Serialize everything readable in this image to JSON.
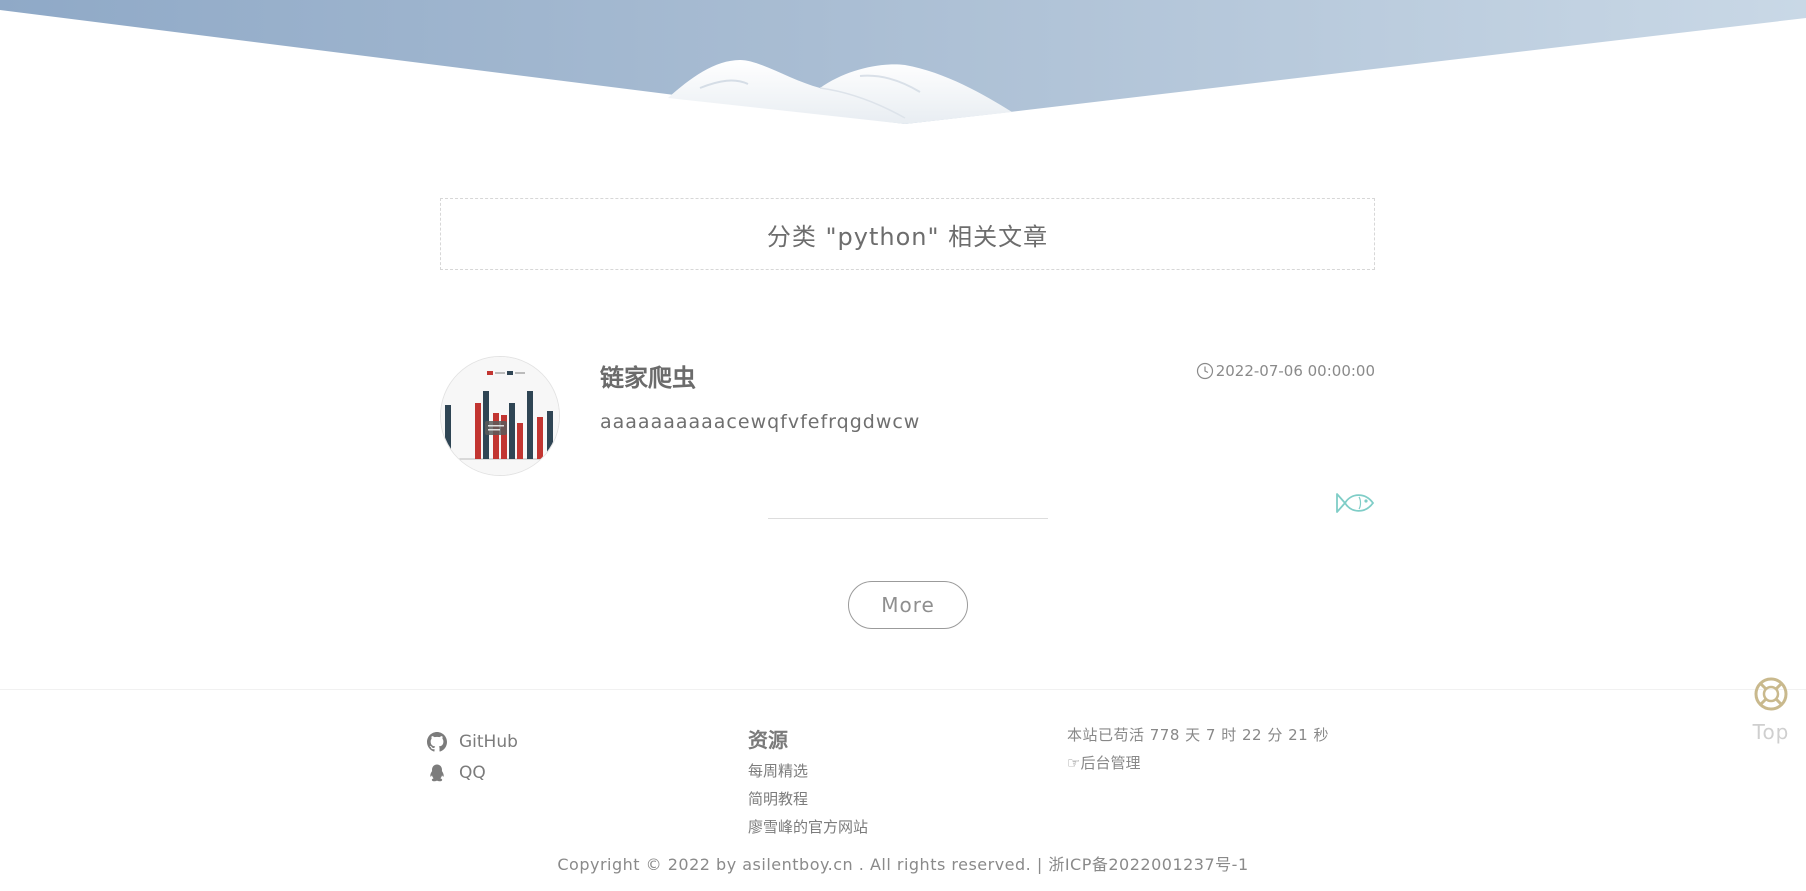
{
  "category": {
    "title": "分类 \"python\" 相关文章"
  },
  "article": {
    "title": "链家爬虫",
    "date": "2022-07-06 00:00:00",
    "summary": "aaaaaaaaaacewqfvfefrqgdwcw",
    "thumbnail_icon": "bar-chart-thumbnail"
  },
  "more_button": {
    "label": "More"
  },
  "footer": {
    "social": [
      {
        "label": "GitHub",
        "icon": "github-icon"
      },
      {
        "label": "QQ",
        "icon": "qq-icon"
      }
    ],
    "resources": {
      "title": "资源",
      "links": [
        "每周精选",
        "简明教程",
        "廖雪峰的官方网站"
      ]
    },
    "uptime": "本站已苟活 778 天 7 时 22 分 21 秒",
    "admin": "☞后台管理",
    "copyright": "Copyright © 2022 by asilentboy.cn . All rights reserved. | 浙ICP备2022001237号-1"
  },
  "back_to_top": {
    "label": "Top"
  },
  "colors": {
    "fish_accent": "#7fcdc7",
    "top_icon": "#c9b98d",
    "bar_red": "#c23531",
    "bar_dark": "#2f4554"
  }
}
